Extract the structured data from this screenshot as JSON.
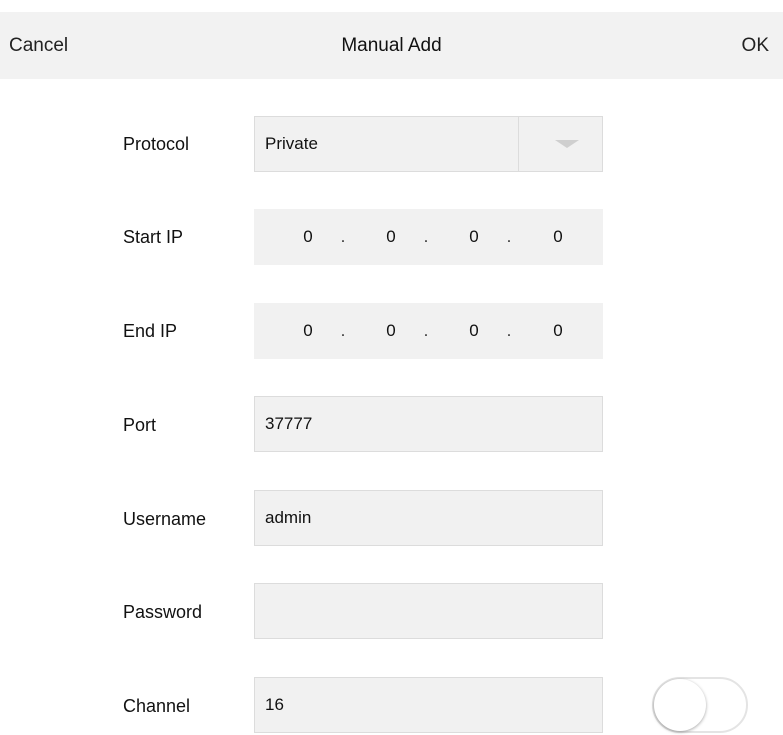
{
  "header": {
    "cancel_label": "Cancel",
    "title": "Manual Add",
    "ok_label": "OK"
  },
  "form": {
    "protocol": {
      "label": "Protocol",
      "value": "Private"
    },
    "start_ip": {
      "label": "Start IP",
      "octets": [
        "0",
        "0",
        "0",
        "0"
      ],
      "separator": "."
    },
    "end_ip": {
      "label": "End IP",
      "octets": [
        "0",
        "0",
        "0",
        "0"
      ],
      "separator": "."
    },
    "port": {
      "label": "Port",
      "value": "37777"
    },
    "username": {
      "label": "Username",
      "value": "admin"
    },
    "password": {
      "label": "Password",
      "value": ""
    },
    "channel": {
      "label": "Channel",
      "value": "16"
    }
  },
  "toggle": {
    "on": false
  },
  "icons": {
    "dropdown": "chevron-down-icon"
  },
  "colors": {
    "header_bg": "#f2f2f2",
    "field_bg": "#f1f1f1",
    "field_border": "#dcdcdc",
    "arrow": "#cfcfcf"
  }
}
